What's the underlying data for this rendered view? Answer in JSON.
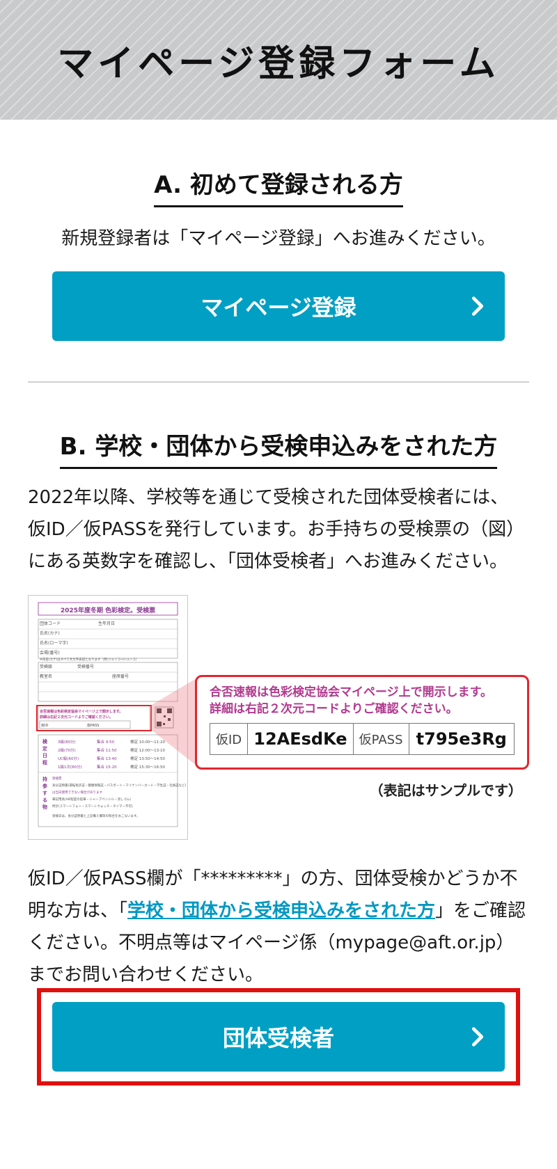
{
  "header": {
    "title": "マイページ登録フォーム"
  },
  "section_a": {
    "title": "A. 初めて登録される方",
    "lead": "新規登録者は「マイページ登録」へお進みください。",
    "button_label": "マイページ登録"
  },
  "section_b": {
    "title": "B. 学校・団体から受検申込みをされた方",
    "lead_line1": "2022年以降、学校等を通じて受検された団体受検者には、",
    "lead_line2": "仮ID／仮PASSを発行しています。お手持ちの受検票の（図）",
    "lead_line3": "にある英数字を確認し、「団体受検者」へお進みください。",
    "ticket": {
      "title": "2025年度冬期 色彩検定。受検票",
      "rows": [
        "団体コード",
        "生年月日",
        "氏名(カナ)",
        "氏名(ローマ字)",
        "会場(番号)",
        "受検級",
        "受検番号",
        "教室名",
        "座席番号"
      ],
      "note": "※氏名(カナ)はすべて大文字表記となります（例:ジュンコ→ジユンコ）",
      "schedule_title": "検定日程",
      "id_label": "仮ID",
      "pass_label": "仮PASS",
      "schedule": [
        {
          "grade": "3級(80分)",
          "entry": "集合 9:50",
          "exam": "検定 10:00〜11:20"
        },
        {
          "grade": "2級(70分)",
          "entry": "集合 11:50",
          "exam": "検定 12:00〜13:10"
        },
        {
          "grade": "UC級(60分)",
          "entry": "集合 13:40",
          "exam": "検定 13:50〜14:50"
        },
        {
          "grade": "1級1次(80分)",
          "entry": "集合 15:20",
          "exam": "検定 15:30〜16:50"
        }
      ],
      "belongings_title": "持参する物",
      "belongings": [
        "受検票",
        "身分証明書(運転免許証・健康保険証・パスポート・マイナンバーカード・学生証・社員証など)",
        "は当日使用できない場合があります",
        "筆記用具(HB程度の鉛筆・シャープペンシル・消しゴム)",
        "時計(スマートフォン・スマートウォッチ・タイマー不可)"
      ],
      "footer": "受検日は、身分証明書と上記備え欄等の照合をおこないます。"
    },
    "zoom_note_line1": "合否速報は色彩検定協会マイページ上で開示します。",
    "zoom_note_line2": "詳細は右記２次元コードよりご確認ください。",
    "id_label": "仮ID",
    "id_value": "12AEsdKe",
    "pass_label": "仮PASS",
    "pass_value": "t795e3Rg",
    "sample_note": "（表記はサンプルです）",
    "para2_part1": "仮ID／仮PASS欄が「*********」の方、団体受検かどうか不明な方は、「",
    "para2_link": "学校・団体から受検申込みをされた方",
    "para2_part2": "」をご確認ください。不明点等はマイページ係（mypage@aft.or.jp）までお問い合わせください。",
    "button_label": "団体受検者"
  },
  "colors": {
    "accent": "#009fc3",
    "highlight": "#e0100f",
    "link": "#0098c2",
    "note": "#b2398e"
  }
}
